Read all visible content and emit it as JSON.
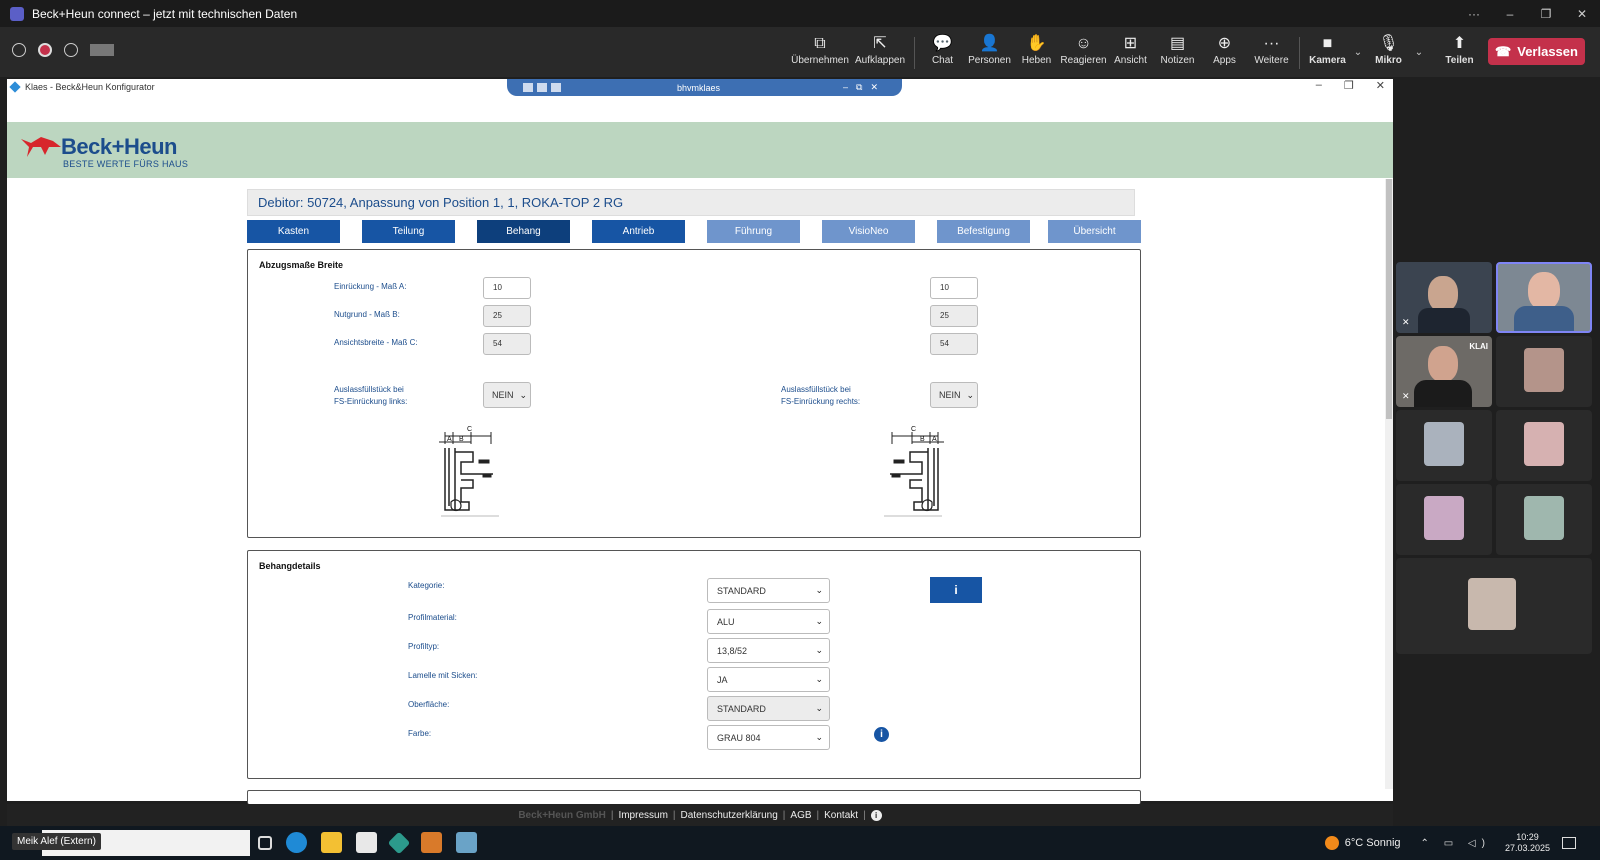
{
  "teams": {
    "window_title": "Beck+Heun connect – jetzt mit technischen Daten",
    "window_controls": [
      "···",
      "–",
      "❐",
      "✕"
    ],
    "toolbar": [
      {
        "label": "Übernehmen",
        "icon": "take-control-icon",
        "glyph": "⧉"
      },
      {
        "label": "Aufklappen",
        "icon": "pop-out-icon",
        "glyph": "⇱"
      },
      {
        "label": "Chat",
        "icon": "chat-icon",
        "glyph": "💬"
      },
      {
        "label": "Personen",
        "icon": "people-icon",
        "glyph": "👤"
      },
      {
        "label": "Heben",
        "icon": "raise-hand-icon",
        "glyph": "✋"
      },
      {
        "label": "Reagieren",
        "icon": "react-icon",
        "glyph": "☺"
      },
      {
        "label": "Ansicht",
        "icon": "view-icon",
        "glyph": "⊞"
      },
      {
        "label": "Notizen",
        "icon": "notes-icon",
        "glyph": "▤"
      },
      {
        "label": "Apps",
        "icon": "apps-icon",
        "glyph": "⊕"
      },
      {
        "label": "Weitere",
        "icon": "more-icon",
        "glyph": "···"
      }
    ],
    "camera": {
      "label": "Kamera",
      "glyph": "■"
    },
    "mic": {
      "label": "Mikro",
      "glyph": "🎙"
    },
    "share": {
      "label": "Teilen",
      "glyph": "⬆"
    },
    "leave": {
      "label": "Verlassen",
      "glyph": "☎"
    },
    "colors": {
      "leave": "#c4314b",
      "accent": "#7f85f5"
    }
  },
  "remote": {
    "window_title": "Klaes - Beck&Heun Konfigurator",
    "rdp_host": "bhvmklaes",
    "rdp_controls": [
      "–",
      "⧉",
      "✕"
    ],
    "window_controls": [
      "–",
      "❐",
      "✕"
    ]
  },
  "brand": {
    "name": "Beck+Heun",
    "slogan": "BESTE WERTE FÜRS HAUS",
    "color": "#1c4d8c",
    "header_bg": "#bcd6c0"
  },
  "debitor_line": "Debitor: 50724, Anpassung von Position 1, 1, ROKA-TOP 2 RG",
  "tabs": [
    {
      "label": "Kasten",
      "state": "dark"
    },
    {
      "label": "Teilung",
      "state": "dark"
    },
    {
      "label": "Behang",
      "state": "active"
    },
    {
      "label": "Antrieb",
      "state": "dark"
    },
    {
      "label": "Führung",
      "state": "light"
    },
    {
      "label": "VisioNeo",
      "state": "light"
    },
    {
      "label": "Befestigung",
      "state": "light"
    },
    {
      "label": "Übersicht",
      "state": "light"
    }
  ],
  "abzug": {
    "title": "Abzugsmaße Breite",
    "fields": [
      {
        "label": "Einrückung - Maß A:",
        "left": "10",
        "right": "10"
      },
      {
        "label": "Nutgrund - Maß B:",
        "left": "25",
        "right": "25"
      },
      {
        "label": "Ansichtsbreite - Maß C:",
        "left": "54",
        "right": "54"
      }
    ],
    "auslass_left_label_1": "Auslassfüllstück bei",
    "auslass_left_label_2": "FS-Einrückung links:",
    "auslass_left_value": "NEIN",
    "auslass_right_label_1": "Auslassfüllstück bei",
    "auslass_right_label_2": "FS-Einrückung rechts:",
    "auslass_right_value": "NEIN",
    "dim_labels": {
      "a": "A",
      "b": "B",
      "c": "C"
    }
  },
  "behang": {
    "title": "Behangdetails",
    "fields": [
      {
        "label": "Kategorie:",
        "value": "STANDARD"
      },
      {
        "label": "Profilmaterial:",
        "value": "ALU"
      },
      {
        "label": "Profiltyp:",
        "value": "13,8/52"
      },
      {
        "label": "Lamelle mit Sicken:",
        "value": "JA"
      },
      {
        "label": "Oberfläche:",
        "value": "STANDARD"
      },
      {
        "label": "Farbe:",
        "value": "GRAU 804"
      }
    ],
    "info_label": "i"
  },
  "footer": {
    "company": "Beck+Heun GmbH",
    "links": [
      "Impressum",
      "Datenschutzerklärung",
      "AGB",
      "Kontakt"
    ],
    "sep": "|",
    "info": "i"
  },
  "taskbar": {
    "presenter": "Meik Alef (Extern)",
    "search_suffix": "n",
    "weather": "6°C Sonnig",
    "time": "10:29",
    "date": "27.03.2025",
    "tray_glyphs": "⌃ ▭ ◁)"
  },
  "gallery": {
    "tile_label": "KLAI",
    "mute_glyph": "✕"
  }
}
